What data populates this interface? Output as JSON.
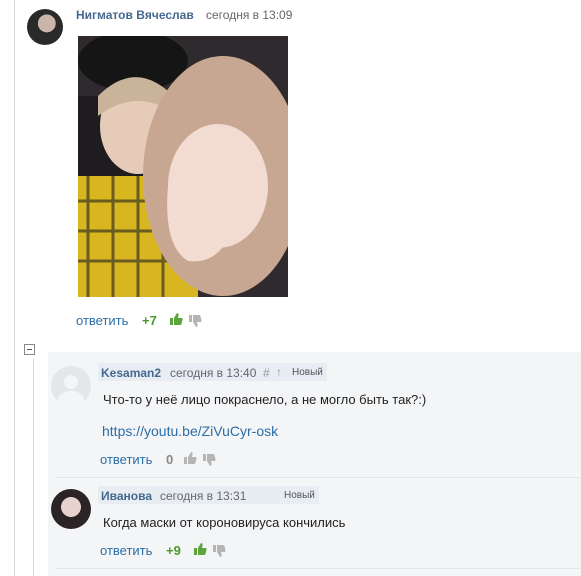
{
  "comments": [
    {
      "author": "Нигматов Вячеслав",
      "time": "сегодня в 13:09",
      "reply_label": "ответить",
      "score": "+7"
    },
    {
      "author": "Kesaman2",
      "time": "сегодня в 13:40",
      "hash": "#",
      "arrow": "↑",
      "badge": "Новый",
      "text": "Что-то у неё лицо покраснело, а не могло быть так?:)",
      "link": "https://youtu.be/ZiVuCyr-osk",
      "reply_label": "ответить",
      "score": "0"
    },
    {
      "author": "Иванова",
      "time": "сегодня в 13:31",
      "badge": "Новый",
      "text": "Когда маски от короновируса кончились",
      "reply_label": "ответить",
      "score": "+9"
    }
  ],
  "collapse_symbol": "⊟",
  "colors": {
    "accent": "#45688e",
    "link": "#2b6ea8",
    "positive": "#4a9a2b"
  },
  "icons": [
    "thumb-up-icon",
    "thumb-down-icon",
    "collapse-icon",
    "user-placeholder-icon"
  ]
}
